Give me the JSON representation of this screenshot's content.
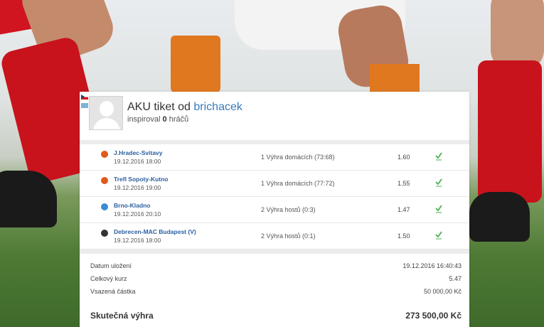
{
  "ticket": {
    "title_prefix": "AKU tiket od",
    "username": "brichacek",
    "inspired_prefix": "inspiroval",
    "inspired_count": "0",
    "inspired_suffix": "hráčů"
  },
  "bets": [
    {
      "match": "J.Hradec-Svitavy",
      "date": "19.12.2016 18:00",
      "tip": "1 Výhra domácích (73:68)",
      "odds": "1.60",
      "sport_icon": "basketball-icon",
      "ball_color": "#e05a1c"
    },
    {
      "match": "Trefl Sopoty-Kutno",
      "date": "19.12.2016 19:00",
      "tip": "1 Výhra domácích (77:72)",
      "odds": "1.55",
      "sport_icon": "basketball-icon",
      "ball_color": "#e05a1c"
    },
    {
      "match": "Brno-Kladno",
      "date": "19.12.2016 20:10",
      "tip": "2 Výhra hostů (0:3)",
      "odds": "1.47",
      "sport_icon": "volleyball-icon",
      "ball_color": "#3a8bd6"
    },
    {
      "match": "Debrecen-MAC Budapest (V)",
      "date": "19.12.2016 18:00",
      "tip": "2 Výhra hostů (0:1)",
      "odds": "1.50",
      "sport_icon": "hockey-puck-icon",
      "ball_color": "#333333"
    }
  ],
  "summary": {
    "saved_label": "Datum uložení",
    "saved_value": "19.12.2016 16:40:43",
    "total_odds_label": "Celkový kurz",
    "total_odds_value": "5.47",
    "stake_label": "Vsazená částka",
    "stake_value": "50 000,00 Kč",
    "win_label": "Skutečná výhra",
    "win_value": "273 500,00 Kč"
  },
  "colors": {
    "win_check": "#4caf50",
    "link": "#3a7ab8"
  }
}
